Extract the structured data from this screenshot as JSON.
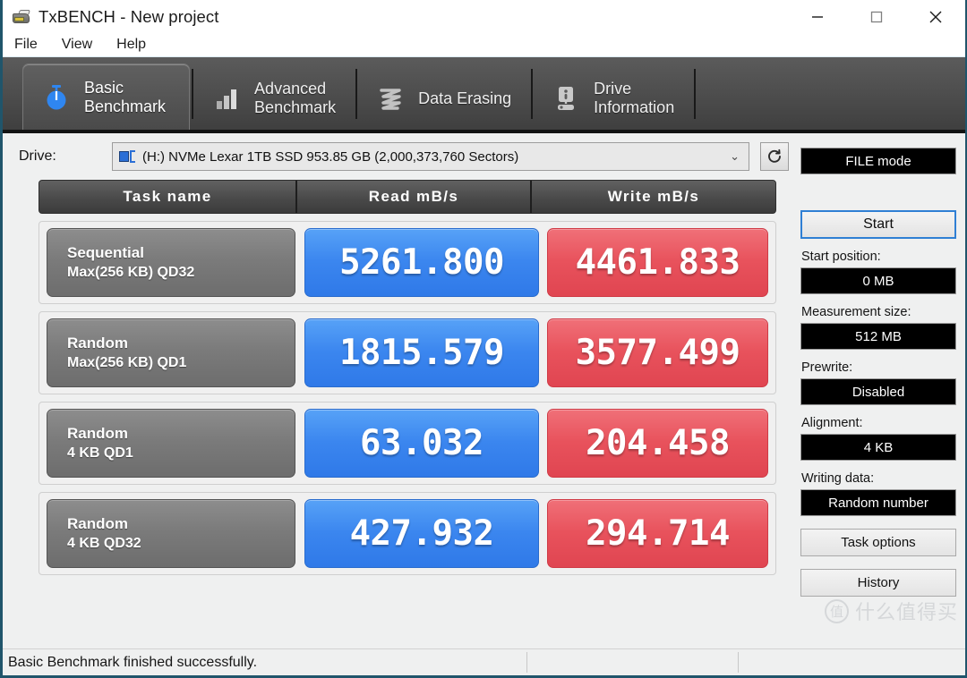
{
  "window": {
    "title": "TxBENCH - New project",
    "app_icon": "txbench-app-icon",
    "controls": {
      "minimize": "minimize-icon",
      "maximize": "maximize-icon",
      "close": "close-icon"
    }
  },
  "menubar": {
    "items": [
      "File",
      "View",
      "Help"
    ]
  },
  "tabs": [
    {
      "id": "basic-benchmark",
      "line1": "Basic",
      "line2": "Benchmark",
      "icon": "stopwatch-icon",
      "active": true
    },
    {
      "id": "advanced-benchmark",
      "line1": "Advanced",
      "line2": "Benchmark",
      "icon": "bar-chart-icon",
      "active": false
    },
    {
      "id": "data-erasing",
      "line1": "Data Erasing",
      "line2": "",
      "icon": "shredder-icon",
      "active": false
    },
    {
      "id": "drive-information",
      "line1": "Drive",
      "line2": "Information",
      "icon": "drive-info-icon",
      "active": false
    }
  ],
  "drive": {
    "label": "Drive:",
    "selected": "(H:) NVMe Lexar 1TB SSD  953.85 GB (2,000,373,760 Sectors)",
    "arrow": "⌄",
    "refresh_icon": "refresh-icon"
  },
  "table": {
    "headers": [
      "Task name",
      "Read mB/s",
      "Write mB/s"
    ],
    "rows": [
      {
        "name_line1": "Sequential",
        "name_line2": "Max(256 KB) QD32",
        "read": "5261.800",
        "write": "4461.833"
      },
      {
        "name_line1": "Random",
        "name_line2": "Max(256 KB) QD1",
        "read": "1815.579",
        "write": "3577.499"
      },
      {
        "name_line1": "Random",
        "name_line2": "4 KB QD1",
        "read": "63.032",
        "write": "204.458"
      },
      {
        "name_line1": "Random",
        "name_line2": "4 KB QD32",
        "read": "427.932",
        "write": "294.714"
      }
    ]
  },
  "sidebar": {
    "mode": "FILE mode",
    "start": "Start",
    "fields": [
      {
        "label": "Start position:",
        "value": "0 MB"
      },
      {
        "label": "Measurement size:",
        "value": "512 MB"
      },
      {
        "label": "Prewrite:",
        "value": "Disabled"
      },
      {
        "label": "Alignment:",
        "value": "4 KB"
      },
      {
        "label": "Writing data:",
        "value": "Random number"
      }
    ],
    "task_options": "Task options",
    "history": "History"
  },
  "statusbar": {
    "message": "Basic Benchmark finished successfully."
  },
  "watermark": {
    "mark": "值",
    "text": "什么值得买"
  },
  "colors": {
    "read_blue": "#3b86ef",
    "write_red": "#e8525c",
    "accent_border": "#20556b",
    "tab_dark": "#4e4e4e",
    "start_outline": "#2f7fd4"
  }
}
